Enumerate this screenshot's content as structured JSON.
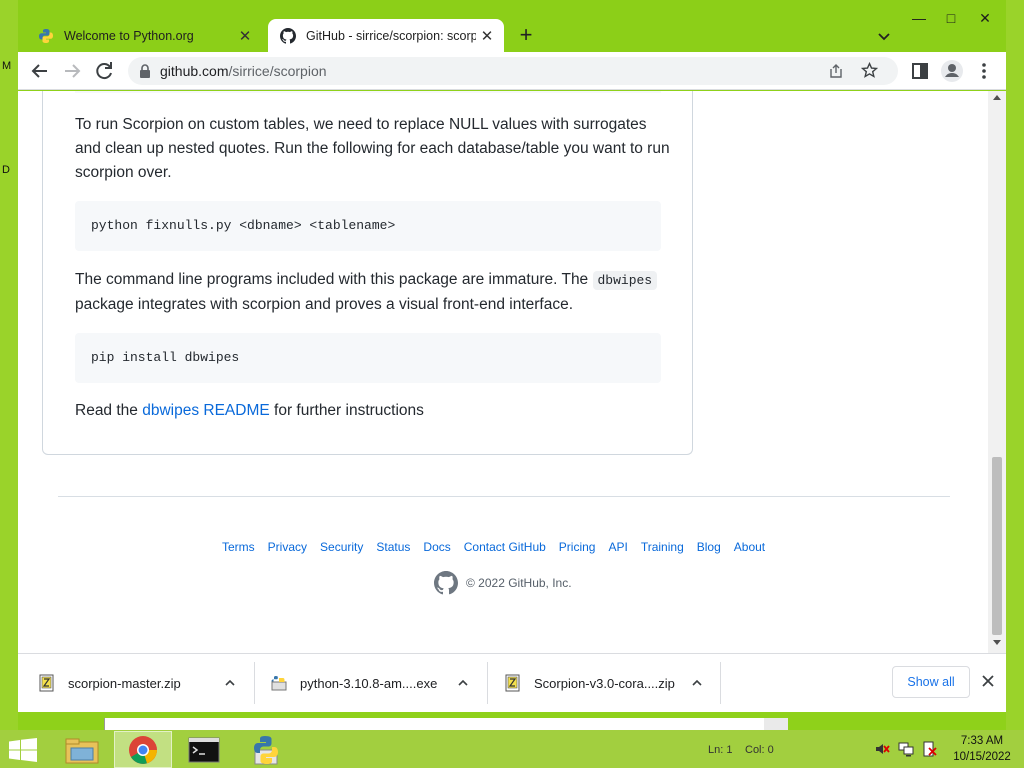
{
  "desktop": {
    "left_label_top": "M",
    "left_label_bottom": "D"
  },
  "browser": {
    "tabs": [
      {
        "title": "Welcome to Python.org",
        "favicon": "python-icon",
        "active": false
      },
      {
        "title": "GitHub - sirrice/scorpion: scorpio",
        "favicon": "github-icon",
        "active": true
      }
    ],
    "new_tab_glyph": "+",
    "window_controls": {
      "minimize": "—",
      "maximize": "□",
      "close": "✕"
    },
    "address": {
      "host": "github.com",
      "path": "/sirrice/scorpion"
    }
  },
  "readme": {
    "para1": "To run Scorpion on custom tables, we need to replace NULL values with surrogates and clean up nested quotes. Run the following for each database/table you want to run scorpion over.",
    "code1": "python fixnulls.py <dbname> <tablename>",
    "para2_before": "The command line programs included with this package are immature. The ",
    "para2_code": "dbwipes",
    "para2_after": " package integrates with scorpion and proves a visual front-end interface.",
    "code2": "pip install dbwipes",
    "para3_before": "Read the ",
    "para3_link": "dbwipes README",
    "para3_after": " for further instructions"
  },
  "footer": {
    "links": [
      "Terms",
      "Privacy",
      "Security",
      "Status",
      "Docs",
      "Contact GitHub",
      "Pricing",
      "API",
      "Training",
      "Blog",
      "About"
    ],
    "copyright": "© 2022 GitHub, Inc."
  },
  "downloads": {
    "items": [
      {
        "name": "scorpion-master.zip",
        "icon": "zip-file-icon"
      },
      {
        "name": "python-3.10.8-am....exe",
        "icon": "python-installer-icon"
      },
      {
        "name": "Scorpion-v3.0-cora....zip",
        "icon": "zip-file-icon"
      }
    ],
    "show_all": "Show all"
  },
  "notepad_status": {
    "ln": "Ln: 1",
    "col": "Col: 0"
  },
  "taskbar": {
    "apps": [
      "file-explorer-icon",
      "chrome-icon",
      "command-prompt-icon",
      "python-icon"
    ],
    "clock_time": "7:33 AM",
    "clock_date": "10/15/2022"
  },
  "colors": {
    "link": "#0969da",
    "desktop": "#8fd11a",
    "taskbar": "#a2cf3f"
  }
}
